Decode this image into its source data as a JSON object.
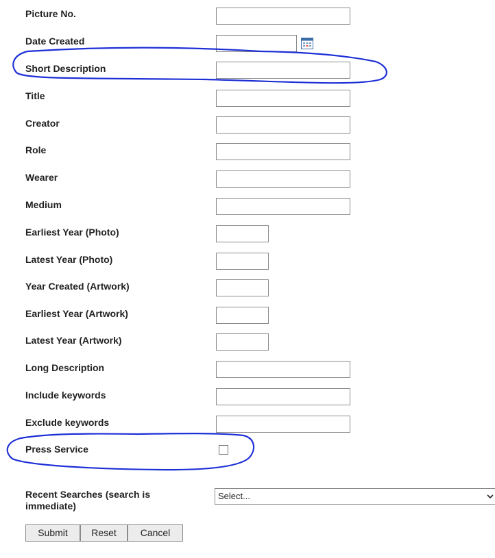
{
  "form": {
    "picture_no": {
      "label": "Picture No.",
      "value": ""
    },
    "date_created": {
      "label": "Date Created",
      "value": ""
    },
    "short_description": {
      "label": "Short Description",
      "value": ""
    },
    "title": {
      "label": "Title",
      "value": ""
    },
    "creator": {
      "label": "Creator",
      "value": ""
    },
    "role": {
      "label": "Role",
      "value": ""
    },
    "wearer": {
      "label": "Wearer",
      "value": ""
    },
    "medium": {
      "label": "Medium",
      "value": ""
    },
    "earliest_year_photo": {
      "label": "Earliest Year (Photo)",
      "value": ""
    },
    "latest_year_photo": {
      "label": "Latest Year (Photo)",
      "value": ""
    },
    "year_created_artwork": {
      "label": "Year Created (Artwork)",
      "value": ""
    },
    "earliest_year_artwork": {
      "label": "Earliest Year (Artwork)",
      "value": ""
    },
    "latest_year_artwork": {
      "label": "Latest Year (Artwork)",
      "value": ""
    },
    "long_description": {
      "label": "Long Description",
      "value": ""
    },
    "include_keywords": {
      "label": "Include keywords",
      "value": ""
    },
    "exclude_keywords": {
      "label": "Exclude keywords",
      "value": ""
    },
    "press_service": {
      "label": "Press Service",
      "checked": false
    },
    "recent_searches": {
      "label_line1": "Recent Searches (search is",
      "label_line2": "immediate)",
      "selected": "Select..."
    }
  },
  "buttons": {
    "submit": "Submit",
    "reset": "Reset",
    "cancel": "Cancel"
  },
  "icons": {
    "date_picker": "calendar-icon",
    "dropdown": "chevron-down-icon"
  },
  "colors": {
    "annotation_stroke": "#1d2fd6",
    "input_border": "#8a8a8a",
    "button_bg": "#ececec"
  }
}
